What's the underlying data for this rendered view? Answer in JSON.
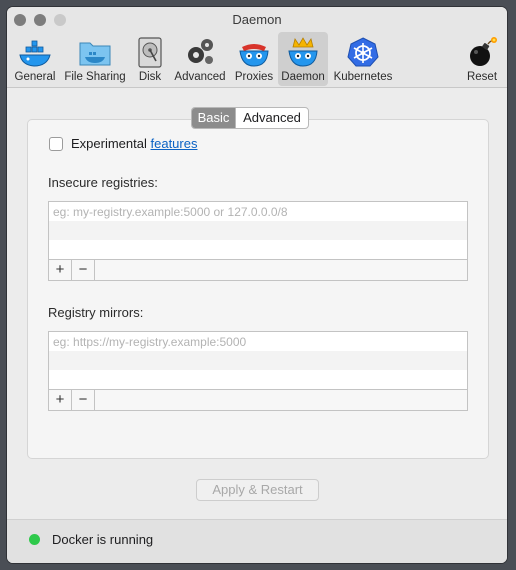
{
  "window": {
    "title": "Daemon"
  },
  "toolbar": {
    "items": [
      {
        "label": "General",
        "icon": "docker-whale-icon"
      },
      {
        "label": "File Sharing",
        "icon": "folder-icon"
      },
      {
        "label": "Disk",
        "icon": "disk-icon"
      },
      {
        "label": "Advanced",
        "icon": "gears-icon"
      },
      {
        "label": "Proxies",
        "icon": "proxies-whale-icon"
      },
      {
        "label": "Daemon",
        "icon": "daemon-whale-icon",
        "selected": true
      },
      {
        "label": "Kubernetes",
        "icon": "kubernetes-icon"
      },
      {
        "label": "Reset",
        "icon": "bomb-icon"
      }
    ]
  },
  "tabs": {
    "basic": "Basic",
    "advanced": "Advanced",
    "active": "Basic"
  },
  "experimental": {
    "label": "Experimental",
    "link": "features",
    "checked": false
  },
  "insecure_registries": {
    "label": "Insecure registries:",
    "placeholder": "eg: my-registry.example:5000 or 127.0.0.0/8"
  },
  "registry_mirrors": {
    "label": "Registry mirrors:",
    "placeholder": "eg: https://my-registry.example:5000"
  },
  "list_buttons": {
    "add": "+",
    "remove": "−"
  },
  "apply_button": {
    "label": "Apply & Restart",
    "enabled": false
  },
  "status": {
    "text": "Docker is running",
    "color": "#2ec94b"
  },
  "colors": {
    "accent": "#0b62c4",
    "docker_blue": "#2496ed",
    "kubernetes_blue": "#326ce5"
  }
}
